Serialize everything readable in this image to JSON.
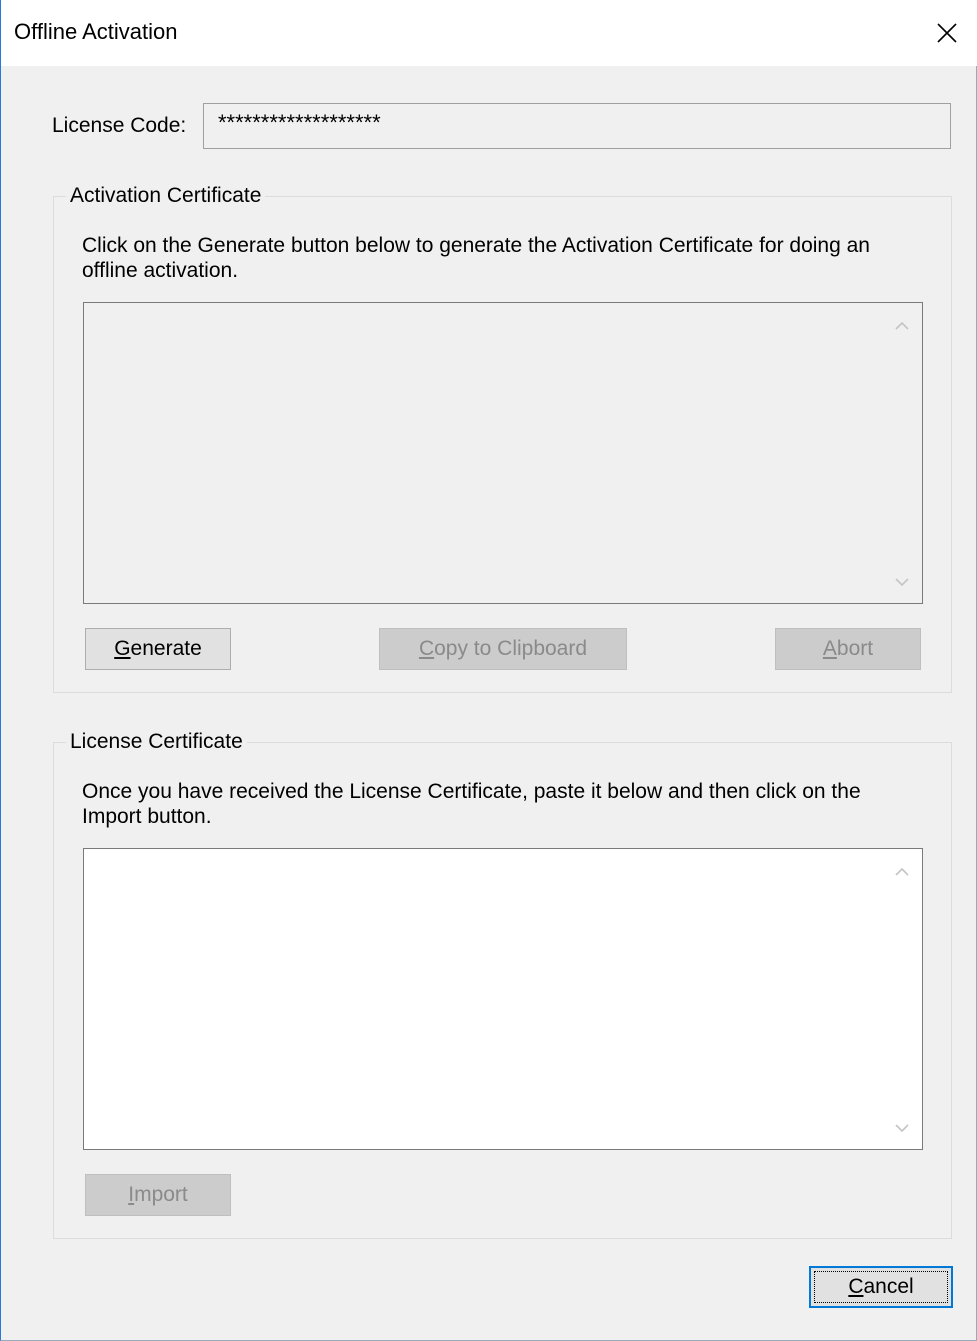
{
  "window": {
    "title": "Offline Activation"
  },
  "license_code": {
    "label": "License Code:",
    "value": "*******************"
  },
  "activation_certificate": {
    "legend": "Activation Certificate",
    "description_line1": "Click on the Generate button below to generate the Activation Certificate for doing an",
    "description_line2": "offline activation.",
    "text_value": "",
    "buttons": {
      "generate": {
        "mnemonic": "G",
        "rest": "enerate"
      },
      "copy": {
        "mnemonic": "C",
        "rest": "opy to Clipboard"
      },
      "abort": {
        "mnemonic": "A",
        "rest": "bort"
      }
    }
  },
  "license_certificate": {
    "legend": "License Certificate",
    "description_line1": "Once you have received the License Certificate, paste it below and then click on the",
    "description_line2": "Import button.",
    "text_value": "",
    "buttons": {
      "import": {
        "mnemonic": "I",
        "rest": "mport"
      }
    }
  },
  "footer": {
    "cancel": {
      "mnemonic": "C",
      "rest": "ancel"
    }
  },
  "colors": {
    "accent": "#0078d7",
    "window_bg": "#f0f0f0",
    "disabled_text": "#8a8a8a"
  }
}
